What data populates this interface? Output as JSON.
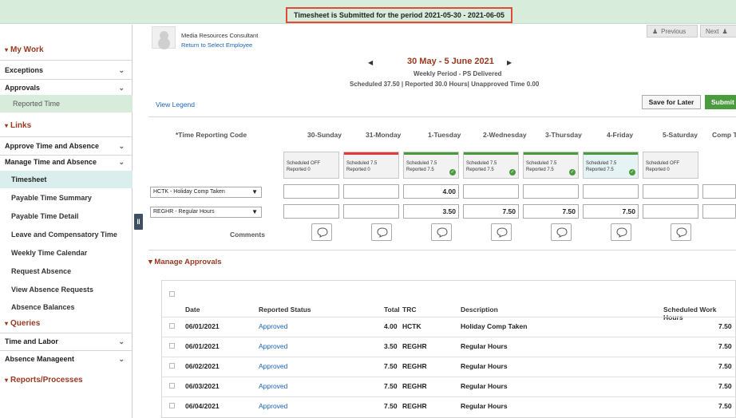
{
  "banner": {
    "text": "Timesheet is Submitted for the period 2021-05-30 - 2021-06-05"
  },
  "sidebar": {
    "my_work": "My Work",
    "exceptions": "Exceptions",
    "approvals": "Approvals",
    "reported_time": "Reported Time",
    "links": "Links",
    "approve_time_absence": "Approve Time and Absence",
    "manage_time_absence": "Manage Time and Absence",
    "items": [
      "Timesheet",
      "Payable Time Summary",
      "Payable Time Detail",
      "Leave and Compensatory Time",
      "Weekly Time Calendar",
      "Request Absence",
      "View Absence Requests",
      "Absence Balances"
    ],
    "queries": "Queries",
    "time_and_labor": "Time and Labor",
    "absence_management": "Absence Manageent",
    "reports_processes": "Reports/Processes"
  },
  "employee": {
    "title": "Media Resources Consultant",
    "return_link": "Return to Select Employee"
  },
  "toolbar": {
    "previous": "Previous",
    "next": "Next",
    "save_for_later": "Save for Later",
    "submit": "Submit",
    "view_legend": "View Legend"
  },
  "period": {
    "range": "30 May - 5 June 2021",
    "weekly": "Weekly Period - PS Delivered",
    "summary": "Scheduled  37.50 | Reported  30.0 Hours| Unapproved Time  0.00"
  },
  "timesheet": {
    "trc_header": "*Time Reporting Code",
    "days": [
      "30-Sunday",
      "31-Monday",
      "1-Tuesday",
      "2-Wednesday",
      "3-Thursday",
      "4-Friday",
      "5-Saturday"
    ],
    "comp_header": "Comp Tim",
    "schedule": [
      {
        "line1": "Scheduled OFF",
        "line2": "Reported  0",
        "bar": "#f2f2f2",
        "ok": false
      },
      {
        "line1": "Scheduled 7.5",
        "line2": "Reported  0",
        "bar": "#e03a3a",
        "ok": false
      },
      {
        "line1": "Scheduled 7.5",
        "line2": "Reported  7.5",
        "bar": "#4a9b3d",
        "ok": true
      },
      {
        "line1": "Scheduled 7.5",
        "line2": "Reported  7.5",
        "bar": "#4a9b3d",
        "ok": true
      },
      {
        "line1": "Scheduled 7.5",
        "line2": "Reported  7.5",
        "bar": "#4a9b3d",
        "ok": true
      },
      {
        "line1": "Scheduled 7.5",
        "line2": "Reported  7.5",
        "bar": "#4a9b3d",
        "ok": true
      },
      {
        "line1": "Scheduled OFF",
        "line2": "Reported  0",
        "bar": "#f2f2f2",
        "ok": false
      }
    ],
    "rows": [
      {
        "trc": "HCTK - Holiday Comp Taken",
        "hours": [
          "",
          "",
          "4.00",
          "",
          "",
          "",
          "",
          ""
        ]
      },
      {
        "trc": "REGHR - Regular Hours",
        "hours": [
          "",
          "",
          "3.50",
          "7.50",
          "7.50",
          "7.50",
          "",
          ""
        ]
      }
    ],
    "comments_label": "Comments"
  },
  "approvals": {
    "title": "Manage Approvals",
    "headers": {
      "date": "Date",
      "status": "Reported Status",
      "total": "Total",
      "trc": "TRC",
      "description": "Description",
      "scheduled": "Scheduled Work Hours"
    },
    "rows": [
      {
        "date": "06/01/2021",
        "status": "Approved",
        "total": "4.00",
        "trc": "HCTK",
        "description": "Holiday Comp Taken",
        "scheduled": "7.50"
      },
      {
        "date": "06/01/2021",
        "status": "Approved",
        "total": "3.50",
        "trc": "REGHR",
        "description": "Regular Hours",
        "scheduled": "7.50"
      },
      {
        "date": "06/02/2021",
        "status": "Approved",
        "total": "7.50",
        "trc": "REGHR",
        "description": "Regular Hours",
        "scheduled": "7.50"
      },
      {
        "date": "06/03/2021",
        "status": "Approved",
        "total": "7.50",
        "trc": "REGHR",
        "description": "Regular Hours",
        "scheduled": "7.50"
      },
      {
        "date": "06/04/2021",
        "status": "Approved",
        "total": "7.50",
        "trc": "REGHR",
        "description": "Regular Hours",
        "scheduled": "7.50"
      }
    ]
  },
  "colors": {
    "accent_brown": "#9a3820",
    "link_blue": "#1a63b8",
    "submit_green": "#4a9b3d",
    "banner_green": "#d8ecdb"
  }
}
